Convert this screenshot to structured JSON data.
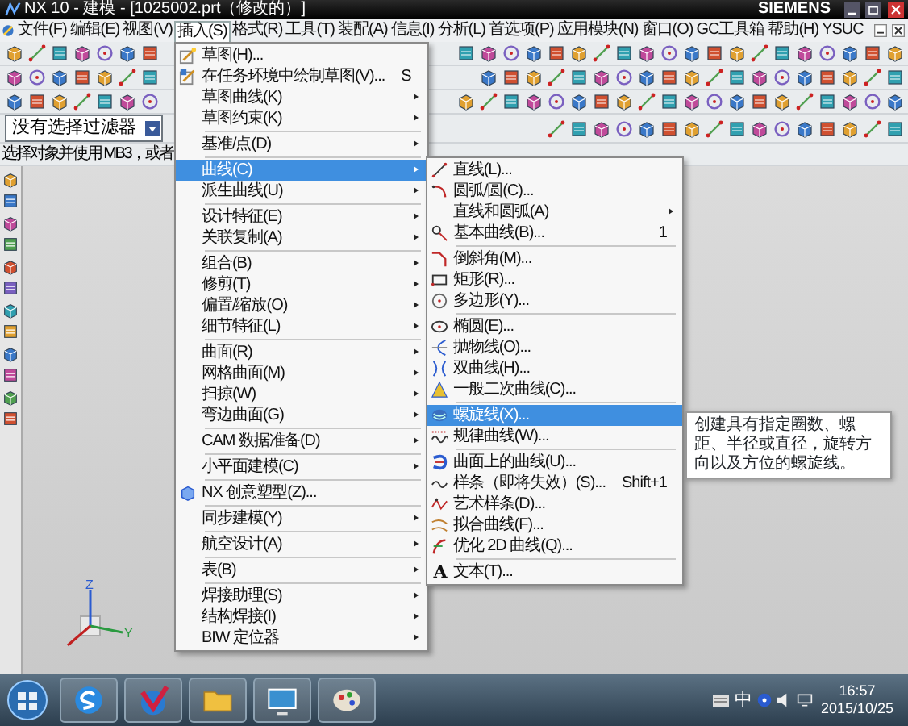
{
  "window": {
    "title": "NX 10 - 建模 - [1025002.prt（修改的）]",
    "brand": "SIEMENS"
  },
  "menu_bar": [
    {
      "label": "文件(F)",
      "selected": false
    },
    {
      "label": "编辑(E)",
      "selected": false
    },
    {
      "label": "视图(V)",
      "selected": false
    },
    {
      "label": "插入(S)",
      "selected": true
    },
    {
      "label": "格式(R)",
      "selected": false
    },
    {
      "label": "工具(T)",
      "selected": false
    },
    {
      "label": "装配(A)",
      "selected": false
    },
    {
      "label": "信息(I)",
      "selected": false
    },
    {
      "label": "分析(L)",
      "selected": false
    },
    {
      "label": "首选项(P)",
      "selected": false
    },
    {
      "label": "应用模块(N)",
      "selected": false
    },
    {
      "label": "窗口(O)",
      "selected": false
    },
    {
      "label": "GC工具箱",
      "selected": false
    },
    {
      "label": "帮助(H)",
      "selected": false
    },
    {
      "label": "YSUC",
      "selected": false
    }
  ],
  "selection_filter": {
    "value": "没有选择过滤器"
  },
  "status_line": "选择对象并使用 MB3，或者",
  "insert_menu": {
    "items": [
      {
        "kind": "item",
        "label": "草图(H)...",
        "submenu": false,
        "selected": false
      },
      {
        "kind": "item",
        "label": "在任务环境中绘制草图(V)...",
        "shortcut": "S",
        "submenu": false,
        "selected": false
      },
      {
        "kind": "item",
        "label": "草图曲线(K)",
        "submenu": true,
        "selected": false
      },
      {
        "kind": "item",
        "label": "草图约束(K)",
        "submenu": true,
        "selected": false
      },
      {
        "kind": "separator"
      },
      {
        "kind": "item",
        "label": "基准/点(D)",
        "submenu": true,
        "selected": false
      },
      {
        "kind": "separator"
      },
      {
        "kind": "item",
        "label": "曲线(C)",
        "submenu": true,
        "selected": true
      },
      {
        "kind": "item",
        "label": "派生曲线(U)",
        "submenu": true,
        "selected": false
      },
      {
        "kind": "separator"
      },
      {
        "kind": "item",
        "label": "设计特征(E)",
        "submenu": true,
        "selected": false
      },
      {
        "kind": "item",
        "label": "关联复制(A)",
        "submenu": true,
        "selected": false
      },
      {
        "kind": "separator"
      },
      {
        "kind": "item",
        "label": "组合(B)",
        "submenu": true,
        "selected": false
      },
      {
        "kind": "item",
        "label": "修剪(T)",
        "submenu": true,
        "selected": false
      },
      {
        "kind": "item",
        "label": "偏置/缩放(O)",
        "submenu": true,
        "selected": false
      },
      {
        "kind": "item",
        "label": "细节特征(L)",
        "submenu": true,
        "selected": false
      },
      {
        "kind": "separator"
      },
      {
        "kind": "item",
        "label": "曲面(R)",
        "submenu": true,
        "selected": false
      },
      {
        "kind": "item",
        "label": "网格曲面(M)",
        "submenu": true,
        "selected": false
      },
      {
        "kind": "item",
        "label": "扫掠(W)",
        "submenu": true,
        "selected": false
      },
      {
        "kind": "item",
        "label": "弯边曲面(G)",
        "submenu": true,
        "selected": false
      },
      {
        "kind": "separator"
      },
      {
        "kind": "item",
        "label": "CAM 数据准备(D)",
        "submenu": true,
        "selected": false
      },
      {
        "kind": "separator"
      },
      {
        "kind": "item",
        "label": "小平面建模(C)",
        "submenu": true,
        "selected": false
      },
      {
        "kind": "separator"
      },
      {
        "kind": "item",
        "label": "NX 创意塑型(Z)...",
        "submenu": false,
        "selected": false
      },
      {
        "kind": "separator"
      },
      {
        "kind": "item",
        "label": "同步建模(Y)",
        "submenu": true,
        "selected": false
      },
      {
        "kind": "separator"
      },
      {
        "kind": "item",
        "label": "航空设计(A)",
        "submenu": true,
        "selected": false
      },
      {
        "kind": "separator"
      },
      {
        "kind": "item",
        "label": "表(B)",
        "submenu": true,
        "selected": false
      },
      {
        "kind": "separator"
      },
      {
        "kind": "item",
        "label": "焊接助理(S)",
        "submenu": true,
        "selected": false
      },
      {
        "kind": "item",
        "label": "结构焊接(I)",
        "submenu": true,
        "selected": false
      },
      {
        "kind": "item",
        "label": "BIW 定位器",
        "submenu": true,
        "selected": false
      }
    ]
  },
  "curve_menu": {
    "items": [
      {
        "kind": "item",
        "label": "直线(L)...",
        "submenu": false,
        "selected": false
      },
      {
        "kind": "item",
        "label": "圆弧/圆(C)...",
        "submenu": false,
        "selected": false
      },
      {
        "kind": "item",
        "label": "直线和圆弧(A)",
        "submenu": true,
        "selected": false
      },
      {
        "kind": "item",
        "label": "基本曲线(B)...",
        "shortcut": "1",
        "submenu": false,
        "selected": false
      },
      {
        "kind": "separator"
      },
      {
        "kind": "item",
        "label": "倒斜角(M)...",
        "submenu": false,
        "selected": false
      },
      {
        "kind": "item",
        "label": "矩形(R)...",
        "submenu": false,
        "selected": false
      },
      {
        "kind": "item",
        "label": "多边形(Y)...",
        "submenu": false,
        "selected": false
      },
      {
        "kind": "separator"
      },
      {
        "kind": "item",
        "label": "椭圆(E)...",
        "submenu": false,
        "selected": false
      },
      {
        "kind": "item",
        "label": "抛物线(O)...",
        "submenu": false,
        "selected": false
      },
      {
        "kind": "item",
        "label": "双曲线(H)...",
        "submenu": false,
        "selected": false
      },
      {
        "kind": "item",
        "label": "一般二次曲线(C)...",
        "submenu": false,
        "selected": false
      },
      {
        "kind": "separator"
      },
      {
        "kind": "item",
        "label": "螺旋线(X)...",
        "submenu": false,
        "selected": true
      },
      {
        "kind": "item",
        "label": "规律曲线(W)...",
        "submenu": false,
        "selected": false
      },
      {
        "kind": "separator"
      },
      {
        "kind": "item",
        "label": "曲面上的曲线(U)...",
        "submenu": false,
        "selected": false
      },
      {
        "kind": "item",
        "label": "样条（即将失效）(S)...",
        "shortcut": "Shift+1",
        "submenu": false,
        "selected": false
      },
      {
        "kind": "item",
        "label": "艺术样条(D)...",
        "submenu": false,
        "selected": false
      },
      {
        "kind": "item",
        "label": "拟合曲线(F)...",
        "submenu": false,
        "selected": false
      },
      {
        "kind": "item",
        "label": "优化 2D 曲线(Q)...",
        "submenu": false,
        "selected": false
      },
      {
        "kind": "separator"
      },
      {
        "kind": "item",
        "label": "文本(T)...",
        "glyph": "A",
        "submenu": false,
        "selected": false
      }
    ]
  },
  "tooltip": "创建具有指定圈数、螺距、半径或直径，旋转方向以及方位的螺旋线。",
  "triad": {
    "labels": [
      "Z",
      "Y"
    ]
  },
  "taskbar": {
    "ime": "中",
    "time": "16:57",
    "date": "2015/10/25"
  }
}
